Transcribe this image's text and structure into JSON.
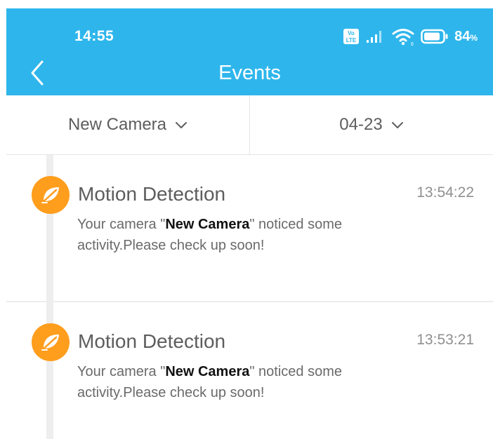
{
  "status_bar": {
    "time": "14:55",
    "battery_percent": "84",
    "battery_suffix": "%",
    "icons": [
      "volte-icon",
      "signal-icon",
      "wifi-icon",
      "battery-icon"
    ]
  },
  "header": {
    "back_icon": "chevron-left-icon",
    "title": "Events"
  },
  "filters": {
    "camera": "New Camera",
    "date": "04-23"
  },
  "events": [
    {
      "icon": "leaf-icon",
      "title": "Motion Detection",
      "time": "13:54:22",
      "desc_prefix": "Your camera \"",
      "camera_name": "New Camera",
      "desc_suffix": "\" noticed some activity.Please check up soon!"
    },
    {
      "icon": "leaf-icon",
      "title": "Motion Detection",
      "time": "13:53:21",
      "desc_prefix": "Your camera \"",
      "camera_name": "New Camera",
      "desc_suffix": "\" noticed some activity.Please check up soon!"
    }
  ],
  "colors": {
    "header": "#2eb6ec",
    "event_icon": "#ff9d1c",
    "text": "#5d5d5d",
    "time": "#8f8f8f",
    "highlight": "#111111"
  }
}
